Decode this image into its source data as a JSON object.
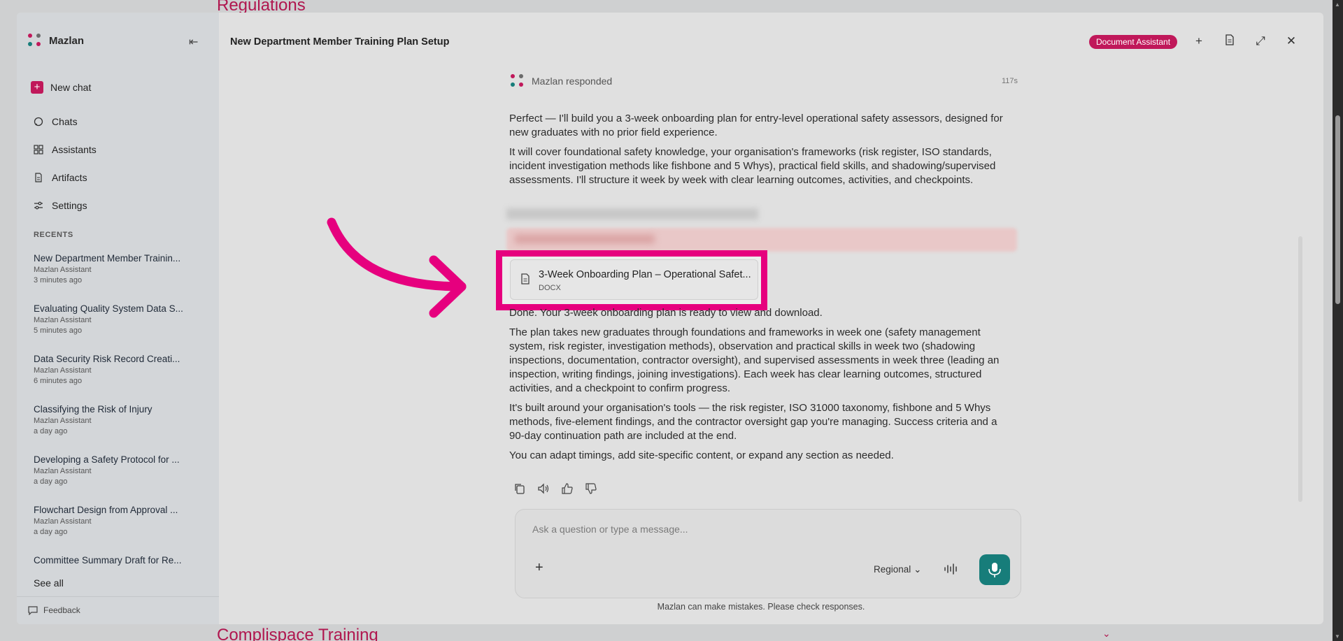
{
  "background": {
    "top_heading": "Regulations",
    "bottom_heading": "Complispace Training"
  },
  "sidebar": {
    "brand": "Mazlan",
    "new_chat": "New chat",
    "nav": [
      {
        "label": "Chats",
        "icon": "chat-icon"
      },
      {
        "label": "Assistants",
        "icon": "grid-icon"
      },
      {
        "label": "Artifacts",
        "icon": "document-icon"
      },
      {
        "label": "Settings",
        "icon": "sliders-icon"
      }
    ],
    "recents_label": "RECENTS",
    "recents": [
      {
        "title": "New Department Member Trainin...",
        "subtitle": "Mazlan Assistant",
        "time": "3 minutes ago"
      },
      {
        "title": "Evaluating Quality System Data S...",
        "subtitle": "Mazlan Assistant",
        "time": "5 minutes ago"
      },
      {
        "title": "Data Security Risk Record Creati...",
        "subtitle": "Mazlan Assistant",
        "time": "6 minutes ago"
      },
      {
        "title": "Classifying the Risk of Injury",
        "subtitle": "Mazlan Assistant",
        "time": "a day ago"
      },
      {
        "title": "Developing a Safety Protocol for ...",
        "subtitle": "Mazlan Assistant",
        "time": "a day ago"
      },
      {
        "title": "Flowchart Design from Approval ...",
        "subtitle": "Mazlan Assistant",
        "time": "a day ago"
      },
      {
        "title": "Committee Summary Draft for Re...",
        "subtitle": "",
        "time": ""
      }
    ],
    "see_all": "See all",
    "feedback": "Feedback"
  },
  "header": {
    "title": "New Department Member Training Plan Setup",
    "assistant_badge": "Document Assistant"
  },
  "chat": {
    "responder": "Mazlan responded",
    "elapsed": "117s",
    "intro_paragraphs": [
      "Perfect — I'll build you a 3-week onboarding plan for entry-level operational safety assessors, designed for new graduates with no prior field experience.",
      "It will cover foundational safety knowledge, your organisation's frameworks (risk register, ISO standards, incident investigation methods like fishbone and 5 Whys), practical field skills, and shadowing/supervised assessments. I'll structure it week by week with clear learning outcomes, activities, and checkpoints."
    ],
    "file": {
      "name": "3-Week Onboarding Plan – Operational Safet...",
      "type": "DOCX"
    },
    "outro_paragraphs": [
      "Done. Your 3-week onboarding plan is ready to view and download.",
      "The plan takes new graduates through foundations and frameworks in week one (safety management system, risk register, investigation methods), observation and practical skills in week two (shadowing inspections, documentation, contractor oversight), and supervised assessments in week three (leading an inspection, writing findings, joining investigations). Each week has clear learning outcomes, structured activities, and a checkpoint to confirm progress.",
      "It's built around your organisation's tools — the risk register, ISO 31000 taxonomy, fishbone and 5 Whys methods, five-element findings, and the contractor oversight gap you're managing. Success criteria and a 90-day continuation path are included at the end.",
      "You can adapt timings, add site-specific content, or expand any section as needed."
    ]
  },
  "composer": {
    "placeholder": "Ask a question or type a message...",
    "region": "Regional",
    "disclaimer": "Mazlan can make mistakes. Please check responses."
  },
  "colors": {
    "brand": "#c0185a",
    "highlight": "#e6007e",
    "mic": "#177d7a"
  }
}
